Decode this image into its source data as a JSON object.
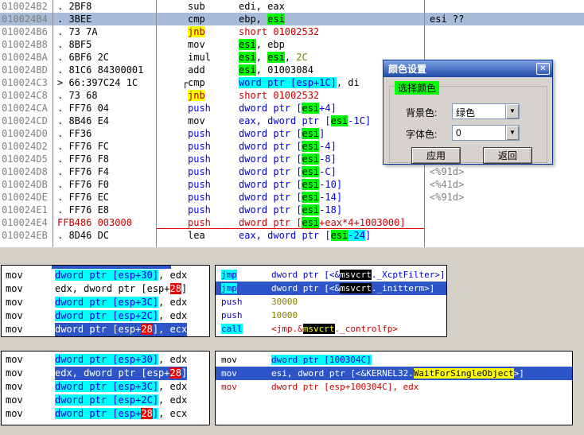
{
  "colors": {
    "sel": "#2D55C8",
    "selInactive": "#A8BCD8",
    "green": "#00FF00",
    "cyan": "#00FFFF",
    "yellow": "#FFFF00",
    "redbg": "#F00000",
    "red": "#C80000",
    "blue": "#0000D8",
    "olive": "#808000",
    "gray": "#808080",
    "codebg": "#FFFFFF",
    "desktop": "#D4D0C8",
    "dialogbg": "#D6D3CE",
    "titlebarTop": "#7FA3E4",
    "titlebarBottom": "#1E4BA8"
  },
  "listing": {
    "rows": [
      {
        "a": "010024B2",
        "y": ". 2BF8",
        "m": [
          {
            "t": "sub",
            "c": "k"
          }
        ],
        "o": [
          {
            "t": "edi, eax",
            "c": "k"
          }
        ]
      },
      {
        "a": "010024B4",
        "y": ". 3BEE",
        "m": [
          {
            "t": "cmp",
            "c": "k"
          }
        ],
        "o": [
          {
            "t": "ebp, ",
            "c": "k"
          },
          {
            "t": "esi",
            "c": "g"
          }
        ],
        "cm": "esi ??",
        "cmc": "k",
        "row": "sel-top"
      },
      {
        "a": "010024B6",
        "y": ". 73 7A",
        "m": [
          {
            "t": "jnb",
            "c": "y"
          }
        ],
        "o": [
          {
            "t": "short 01002532",
            "c": "r"
          }
        ]
      },
      {
        "a": "010024B8",
        "y": ". 8BF5",
        "m": [
          {
            "t": "mov",
            "c": "k"
          }
        ],
        "o": [
          {
            "t": "esi",
            "c": "g"
          },
          {
            "t": ", ebp",
            "c": "k"
          }
        ]
      },
      {
        "a": "010024BA",
        "y": ". 6BF6 2C",
        "m": [
          {
            "t": "imul",
            "c": "k"
          }
        ],
        "o": [
          {
            "t": "esi",
            "c": "g"
          },
          {
            "t": ", ",
            "c": "k"
          },
          {
            "t": "esi",
            "c": "g"
          },
          {
            "t": ", ",
            "c": "k"
          },
          {
            "t": "2C",
            "c": "o"
          }
        ]
      },
      {
        "a": "010024BD",
        "y": ". 81C6 84300001",
        "m": [
          {
            "t": "add",
            "c": "k"
          }
        ],
        "o": [
          {
            "t": "esi",
            "c": "g"
          },
          {
            "t": ", 01003084",
            "c": "k"
          }
        ]
      },
      {
        "a": "010024C3",
        "y": "> 66:397C24 1C",
        "br": "┌",
        "m": [
          {
            "t": "cmp",
            "c": "k"
          }
        ],
        "o": [
          {
            "t": "word ptr [esp+1C]",
            "c": "c"
          },
          {
            "t": ", di",
            "c": "k"
          }
        ]
      },
      {
        "a": "010024C8",
        "y": ". 73 68",
        "m": [
          {
            "t": "jnb",
            "c": "y"
          }
        ],
        "o": [
          {
            "t": "short 01002532",
            "c": "r"
          }
        ]
      },
      {
        "a": "010024CA",
        "y": ". FF76 04",
        "m": [
          {
            "t": "push",
            "c": "b"
          }
        ],
        "o": [
          {
            "t": "dword ptr [",
            "c": "b"
          },
          {
            "t": "esi",
            "c": "g"
          },
          {
            "t": "+4]",
            "c": "b"
          }
        ]
      },
      {
        "a": "010024CD",
        "y": ". 8B46 E4",
        "m": [
          {
            "t": "mov",
            "c": "k"
          }
        ],
        "o": [
          {
            "t": "eax, dword ptr [",
            "c": "b"
          },
          {
            "t": "esi",
            "c": "g"
          },
          {
            "t": "-1C]",
            "c": "b"
          }
        ]
      },
      {
        "a": "010024D0",
        "y": ". FF36",
        "m": [
          {
            "t": "push",
            "c": "b"
          }
        ],
        "o": [
          {
            "t": "dword ptr [",
            "c": "b"
          },
          {
            "t": "esi",
            "c": "g"
          },
          {
            "t": "]",
            "c": "b"
          }
        ]
      },
      {
        "a": "010024D2",
        "y": ". FF76 FC",
        "m": [
          {
            "t": "push",
            "c": "b"
          }
        ],
        "o": [
          {
            "t": "dword ptr [",
            "c": "b"
          },
          {
            "t": "esi",
            "c": "g"
          },
          {
            "t": "-4]",
            "c": "b"
          }
        ]
      },
      {
        "a": "010024D5",
        "y": ". FF76 F8",
        "m": [
          {
            "t": "push",
            "c": "b"
          }
        ],
        "o": [
          {
            "t": "dword ptr [",
            "c": "b"
          },
          {
            "t": "esi",
            "c": "g"
          },
          {
            "t": "-8]",
            "c": "b"
          }
        ]
      },
      {
        "a": "010024D8",
        "y": ". FF76 F4",
        "m": [
          {
            "t": "push",
            "c": "b"
          }
        ],
        "o": [
          {
            "t": "dword ptr [",
            "c": "b"
          },
          {
            "t": "esi",
            "c": "g"
          },
          {
            "t": "-C]",
            "c": "b"
          }
        ],
        "cm": "<%91d>"
      },
      {
        "a": "010024DB",
        "y": ". FF76 F0",
        "m": [
          {
            "t": "push",
            "c": "b"
          }
        ],
        "o": [
          {
            "t": "dword ptr [",
            "c": "b"
          },
          {
            "t": "esi",
            "c": "g"
          },
          {
            "t": "-10]",
            "c": "b"
          }
        ],
        "cm": "<%41d>"
      },
      {
        "a": "010024DE",
        "y": ". FF76 EC",
        "m": [
          {
            "t": "push",
            "c": "b"
          }
        ],
        "o": [
          {
            "t": "dword ptr [",
            "c": "b"
          },
          {
            "t": "esi",
            "c": "g"
          },
          {
            "t": "-14]",
            "c": "b"
          }
        ],
        "cm": "<%91d>"
      },
      {
        "a": "010024E1",
        "y": ". FF76 E8",
        "m": [
          {
            "t": "push",
            "c": "b"
          }
        ],
        "o": [
          {
            "t": "dword ptr [",
            "c": "b"
          },
          {
            "t": "esi",
            "c": "g"
          },
          {
            "t": "-18]",
            "c": "b"
          }
        ]
      },
      {
        "a": "010024E4",
        "y": "FFB486 003000",
        "yc": "r",
        "m": [
          {
            "t": "push",
            "c": "r"
          }
        ],
        "o": [
          {
            "t": "dword ptr [",
            "c": "r"
          },
          {
            "t": "esi",
            "c": "g"
          },
          {
            "t": "+eax*4+1003000]",
            "c": "r"
          }
        ],
        "row": "redline"
      },
      {
        "a": "010024EB",
        "y": ". 8D46 DC",
        "m": [
          {
            "t": "lea",
            "c": "k"
          }
        ],
        "o": [
          {
            "t": "eax, dword ptr [",
            "c": "b"
          },
          {
            "t": "esi",
            "c": "g"
          },
          {
            "t": "-24",
            "c": "c"
          },
          {
            "t": "]",
            "c": "b"
          }
        ]
      }
    ]
  },
  "dialog": {
    "title": "颜色设置",
    "close_glyph": "✕",
    "group_label": "选择颜色",
    "dropdown_arrow": "▼",
    "fields": [
      {
        "label": "背景色:",
        "value": "绿色"
      },
      {
        "label": "字体色:",
        "value": "0"
      }
    ],
    "buttons": [
      {
        "label": "应用"
      },
      {
        "label": "返回"
      }
    ]
  },
  "panels": [
    {
      "name": "panel-top-left",
      "sliver": true,
      "rows": [
        {
          "m": [
            {
              "t": "mov",
              "c": "k"
            }
          ],
          "o": [
            {
              "t": "dword ptr [esp+30]",
              "c": "c"
            },
            {
              "t": ", edx",
              "c": "k"
            }
          ]
        },
        {
          "m": [
            {
              "t": "mov",
              "c": "k"
            }
          ],
          "o": [
            {
              "t": "edx, dword ptr [esp+",
              "c": "k"
            },
            {
              "t": "28",
              "c": "hr"
            },
            {
              "t": "]",
              "c": "k"
            }
          ]
        },
        {
          "m": [
            {
              "t": "mov",
              "c": "k"
            }
          ],
          "o": [
            {
              "t": "dword ptr [esp+3C]",
              "c": "c"
            },
            {
              "t": ", edx",
              "c": "k"
            }
          ]
        },
        {
          "m": [
            {
              "t": "mov",
              "c": "k"
            }
          ],
          "o": [
            {
              "t": "dword ptr [esp+2C]",
              "c": "c"
            },
            {
              "t": ", edx",
              "c": "k"
            }
          ]
        },
        {
          "m": [
            {
              "t": "mov",
              "c": "k"
            }
          ],
          "opssel": true,
          "o": [
            {
              "t": "dword ptr [esp+",
              "c": "w"
            },
            {
              "t": "28",
              "c": "hr"
            },
            {
              "t": "], ecx",
              "c": "w"
            }
          ]
        }
      ]
    },
    {
      "name": "panel-top-right",
      "rows": [
        {
          "m": [
            {
              "t": "jmp",
              "c": "c"
            }
          ],
          "o": [
            {
              "t": "dword ptr [<&",
              "c": "b"
            },
            {
              "t": "msvcrt",
              "c": "hb"
            },
            {
              "t": "._XcptFilter>]",
              "c": "b"
            }
          ]
        },
        {
          "row": "sel",
          "m": [
            {
              "t": "jmp",
              "c": "c"
            }
          ],
          "o": [
            {
              "t": "dword ptr [<&",
              "c": "w"
            },
            {
              "t": "msvcrt",
              "c": "hb"
            },
            {
              "t": "._initterm>]",
              "c": "w"
            }
          ]
        },
        {
          "m": [
            {
              "t": "push",
              "c": "b"
            }
          ],
          "o": [
            {
              "t": "30000",
              "c": "o"
            }
          ]
        },
        {
          "m": [
            {
              "t": "push",
              "c": "b"
            }
          ],
          "o": [
            {
              "t": "10000",
              "c": "o"
            }
          ]
        },
        {
          "m": [
            {
              "t": "call",
              "c": "c"
            }
          ],
          "o": [
            {
              "t": "<jmp.&",
              "c": "r"
            },
            {
              "t": "msvcrt",
              "c": "hby"
            },
            {
              "t": "._controlfp>",
              "c": "r"
            }
          ]
        }
      ]
    },
    {
      "name": "panel-bottom-left",
      "rows": [
        {
          "m": [
            {
              "t": "mov",
              "c": "k"
            }
          ],
          "o": [
            {
              "t": "dword ptr [esp+30]",
              "c": "c"
            },
            {
              "t": ", edx",
              "c": "k"
            }
          ]
        },
        {
          "m": [
            {
              "t": "mov",
              "c": "k"
            }
          ],
          "opssel": true,
          "o": [
            {
              "t": "edx, dword ptr [esp+",
              "c": "w"
            },
            {
              "t": "28",
              "c": "hr"
            },
            {
              "t": "]",
              "c": "w"
            }
          ]
        },
        {
          "m": [
            {
              "t": "mov",
              "c": "k"
            }
          ],
          "o": [
            {
              "t": "dword ptr [esp+3C]",
              "c": "c"
            },
            {
              "t": ", edx",
              "c": "k"
            }
          ]
        },
        {
          "m": [
            {
              "t": "mov",
              "c": "k"
            }
          ],
          "o": [
            {
              "t": "dword ptr [esp+2C]",
              "c": "c"
            },
            {
              "t": ", edx",
              "c": "k"
            }
          ]
        },
        {
          "m": [
            {
              "t": "mov",
              "c": "k"
            }
          ],
          "o": [
            {
              "t": "dword ptr [esp+",
              "c": "c"
            },
            {
              "t": "28",
              "c": "hr"
            },
            {
              "t": "]",
              "c": "c"
            },
            {
              "t": ", ecx",
              "c": "k"
            }
          ]
        }
      ]
    },
    {
      "name": "panel-bottom-right",
      "rows": [
        {
          "m": [
            {
              "t": "mov",
              "c": "k"
            }
          ],
          "o": [
            {
              "t": "dword ptr [100304C]",
              "c": "c"
            }
          ]
        },
        {
          "row": "sel",
          "m": [
            {
              "t": "mov",
              "c": "w"
            }
          ],
          "o": [
            {
              "t": "esi, dword ptr [<&KERNEL32.",
              "c": "w"
            },
            {
              "t": "WaitForSingleObject",
              "c": "hy"
            },
            {
              "t": ">]",
              "c": "w"
            }
          ]
        },
        {
          "m": [
            {
              "t": "mov",
              "c": "r"
            }
          ],
          "o": [
            {
              "t": "dword ptr [esp+100304C], edx",
              "c": "r"
            }
          ]
        }
      ]
    }
  ]
}
